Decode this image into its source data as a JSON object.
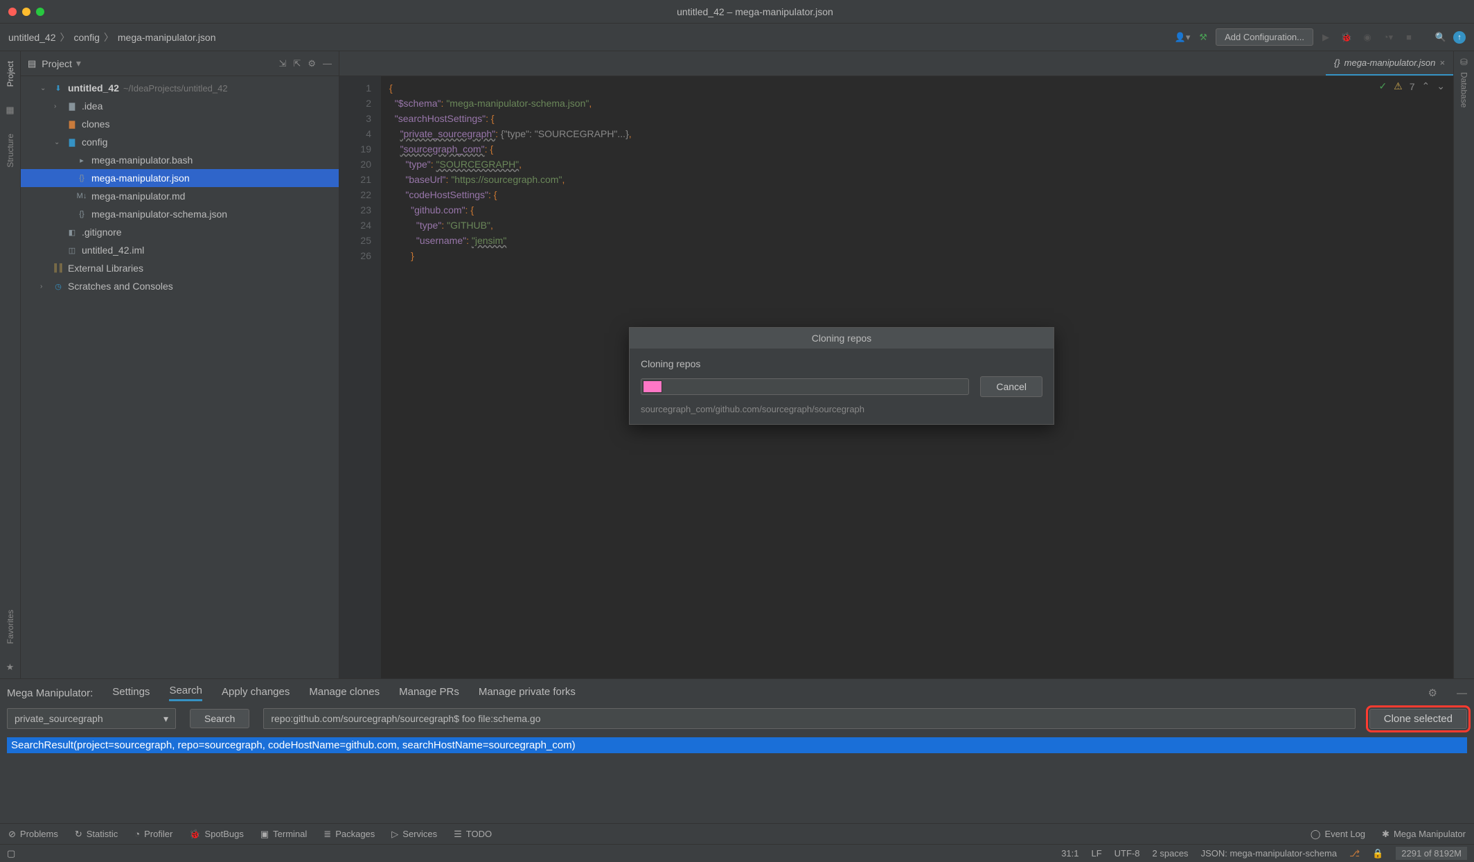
{
  "titlebar": {
    "title": "untitled_42 – mega-manipulator.json"
  },
  "breadcrumb": {
    "items": [
      "untitled_42",
      "config",
      "mega-manipulator.json"
    ]
  },
  "navbar": {
    "add_config": "Add Configuration..."
  },
  "left_rail": [
    "Project",
    "Structure",
    "Favorites"
  ],
  "right_rail": [
    "Database"
  ],
  "project": {
    "title": "Project",
    "root_name": "untitled_42",
    "root_path": "~/IdeaProjects/untitled_42",
    "nodes": [
      {
        "name": ".idea",
        "kind": "folder",
        "level": 2,
        "expandable": true
      },
      {
        "name": "clones",
        "kind": "folder-orange",
        "level": 2
      },
      {
        "name": "config",
        "kind": "folder-blue",
        "level": 2,
        "expanded": true
      },
      {
        "name": "mega-manipulator.bash",
        "kind": "file",
        "level": 3
      },
      {
        "name": "mega-manipulator.json",
        "kind": "file",
        "level": 3,
        "selected": true
      },
      {
        "name": "mega-manipulator.md",
        "kind": "file",
        "level": 3
      },
      {
        "name": "mega-manipulator-schema.json",
        "kind": "file",
        "level": 3
      },
      {
        "name": ".gitignore",
        "kind": "file",
        "level": 2
      },
      {
        "name": "untitled_42.iml",
        "kind": "file",
        "level": 2
      }
    ],
    "external": "External Libraries",
    "scratches": "Scratches and Consoles"
  },
  "editor": {
    "tab_name": "mega-manipulator.json",
    "inspections_count": "7",
    "gutter_lines": [
      "1",
      "2",
      "3",
      "4",
      "19",
      "20",
      "21",
      "22",
      "23",
      "24",
      "25",
      "26"
    ],
    "lines": [
      "{",
      "  \"$schema\": \"mega-manipulator-schema.json\",",
      "  \"searchHostSettings\": {",
      "    \"private_sourcegraph\": {\"type\": \"SOURCEGRAPH\"...},",
      "    \"sourcegraph_com\": {",
      "      \"type\": \"SOURCEGRAPH\",",
      "      \"baseUrl\": \"https://sourcegraph.com\",",
      "      \"codeHostSettings\": {",
      "        \"github.com\": {",
      "          \"type\": \"GITHUB\",",
      "          \"username\": \"jensim\"",
      "        }"
    ]
  },
  "dialog": {
    "title": "Cloning repos",
    "label": "Cloning repos",
    "cancel": "Cancel",
    "subtext": "sourcegraph_com/github.com/sourcegraph/sourcegraph"
  },
  "mm": {
    "label": "Mega Manipulator:",
    "tabs": [
      "Settings",
      "Search",
      "Apply changes",
      "Manage clones",
      "Manage PRs",
      "Manage private forks"
    ],
    "active_tab": "Search",
    "select_value": "private_sourcegraph",
    "search_label": "Search",
    "query": "repo:github.com/sourcegraph/sourcegraph$ foo file:schema.go",
    "clone_label": "Clone selected",
    "result": "SearchResult(project=sourcegraph, repo=sourcegraph, codeHostName=github.com, searchHostName=sourcegraph_com)"
  },
  "bottom_tools": [
    "Problems",
    "Statistic",
    "Profiler",
    "SpotBugs",
    "Terminal",
    "Packages",
    "Services",
    "TODO"
  ],
  "bottom_tools_right": [
    "Event Log",
    "Mega Manipulator"
  ],
  "statusbar": {
    "pos": "31:1",
    "eol": "LF",
    "encoding": "UTF-8",
    "indent": "2 spaces",
    "schema": "JSON: mega-manipulator-schema",
    "memory": "2291 of 8192M"
  }
}
